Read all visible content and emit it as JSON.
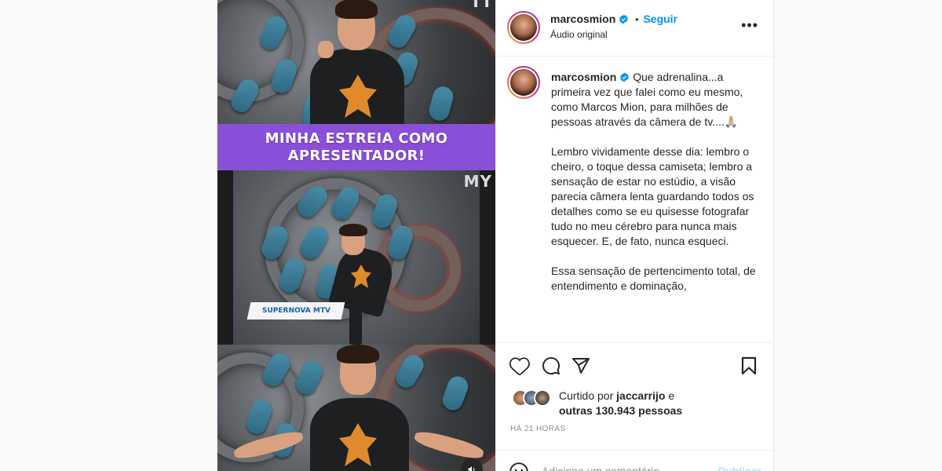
{
  "colors": {
    "accent": "#0095f6",
    "banner": "#8a4fd8",
    "text": "#262626",
    "muted": "#8e8e8e"
  },
  "post": {
    "username": "marcosmion",
    "follow_label": "Seguir",
    "dot": "•",
    "audio": "Áudio original",
    "more_icon": "more-options-icon"
  },
  "video": {
    "banner_line1": "MINHA ESTREIA COMO",
    "banner_line2": "APRESENTADOR!",
    "lower_third": "SUPERNOVA MTV",
    "corner_text": "MY",
    "corner_text_top": "TT"
  },
  "caption": {
    "username": "marcosmion",
    "paragraphs": [
      "Que adrenalina...a primeira vez que falei como eu mesmo, como Marcos Mion, para milhões de pessoas através da câmera de tv....🙏🏼",
      "Lembro vividamente desse dia: lembro o cheiro, o toque dessa camiseta; lembro a sensação de estar no estúdio, a visão parecia câmera lenta guardando todos os detalhes como se eu quisesse fotografar tudo no meu cérebro para nunca mais esquecer. E, de fato, nunca esqueci.",
      "Essa sensação de pertencimento total, de entendimento e dominação,"
    ]
  },
  "likes": {
    "prefix": "Curtido por",
    "user": "jaccarrijo",
    "conj": "e",
    "others": "outras 130.943 pessoas"
  },
  "time": "HÁ 21 HORAS",
  "comment": {
    "placeholder": "Adicione um comentário...",
    "publish_label": "Publicar"
  }
}
